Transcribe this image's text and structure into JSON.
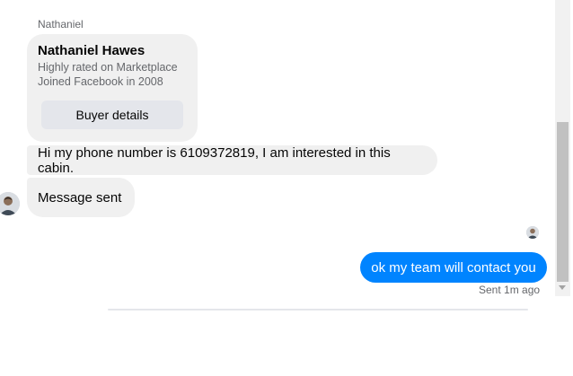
{
  "conversation": {
    "sender_label": "Nathaniel",
    "profile_card": {
      "name": "Nathaniel Hawes",
      "line1": "Highly rated on Marketplace",
      "line2": "Joined Facebook in 2008",
      "button_label": "Buyer details"
    },
    "messages": [
      {
        "direction": "incoming",
        "text": "Hi my phone number is 6109372819, I am interested in this cabin."
      },
      {
        "direction": "incoming",
        "text": "Message sent"
      },
      {
        "direction": "outgoing",
        "text": "ok my team will contact you"
      }
    ],
    "sent_status": "Sent 1m ago"
  },
  "colors": {
    "outgoing_bubble": "#0084ff",
    "incoming_bubble": "#f0f0f0",
    "secondary_text": "#65676b"
  },
  "icons": {
    "avatar": "user-avatar",
    "seen_indicator": "seen-avatar-icon",
    "scroll_down": "scroll-down-arrow-icon"
  }
}
